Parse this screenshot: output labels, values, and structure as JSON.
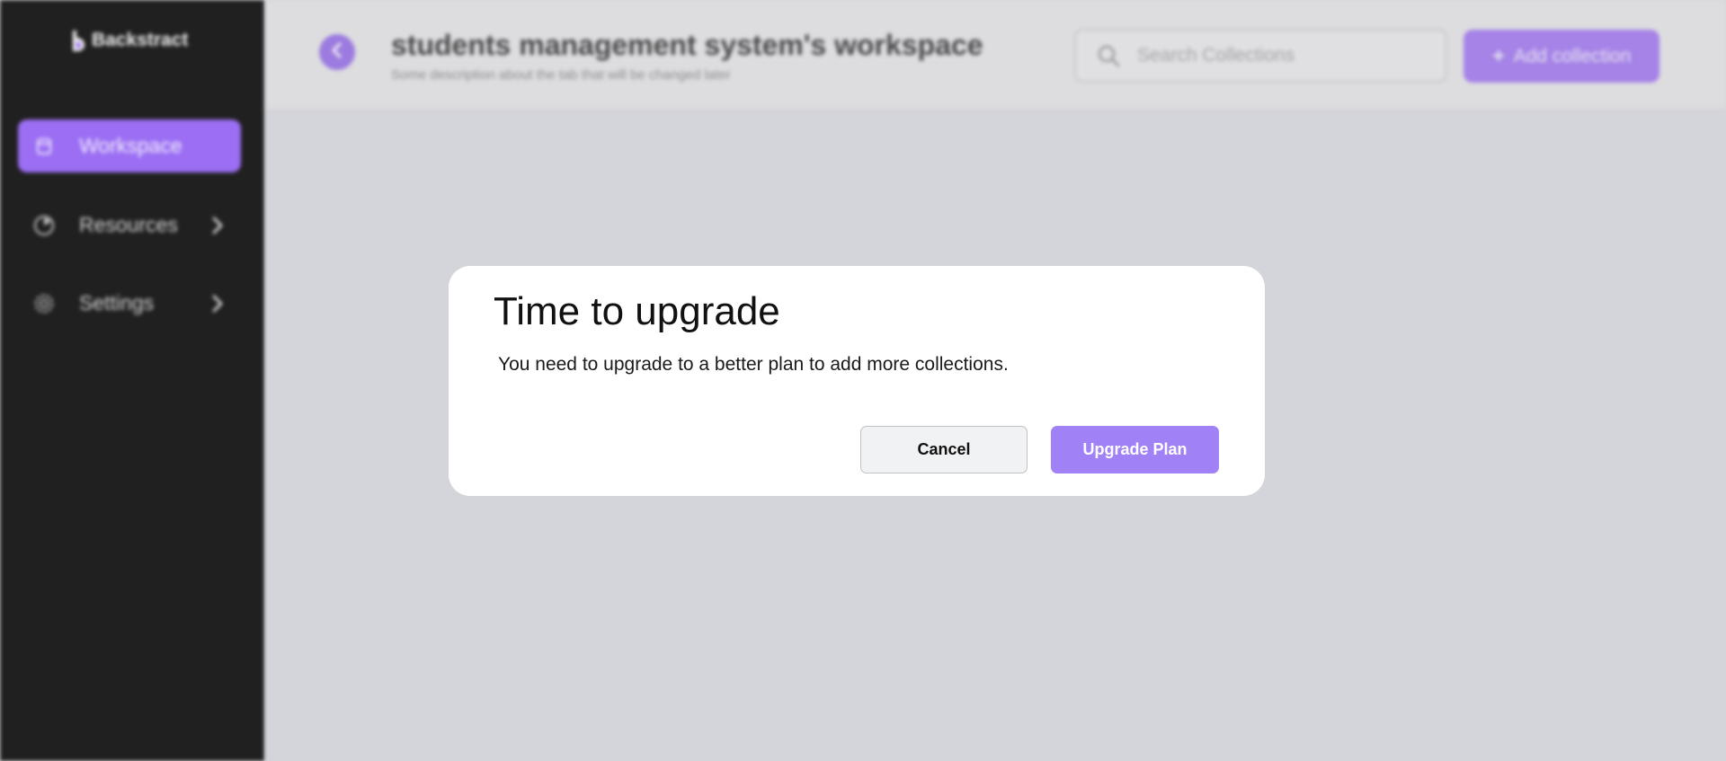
{
  "sidebar": {
    "brand": "Backstract",
    "items": [
      {
        "label": "Workspace",
        "icon": "workspace-icon",
        "active": true
      },
      {
        "label": "Resources",
        "icon": "resources-icon",
        "active": false
      },
      {
        "label": "Settings",
        "icon": "gear-icon",
        "active": false
      }
    ]
  },
  "header": {
    "title": "students management system's workspace",
    "subtitle": "Some description about the tab that will be changed later",
    "search_placeholder": "Search Collections",
    "add_button": "Add collection"
  },
  "modal": {
    "title": "Time to upgrade",
    "body": "You need to upgrade to a better plan to add more collections.",
    "cancel_label": "Cancel",
    "upgrade_label": "Upgrade Plan"
  },
  "colors": {
    "accent": "#9b6ef3",
    "sidebar_bg": "#202020",
    "upgrade_button": "#a181f6"
  }
}
